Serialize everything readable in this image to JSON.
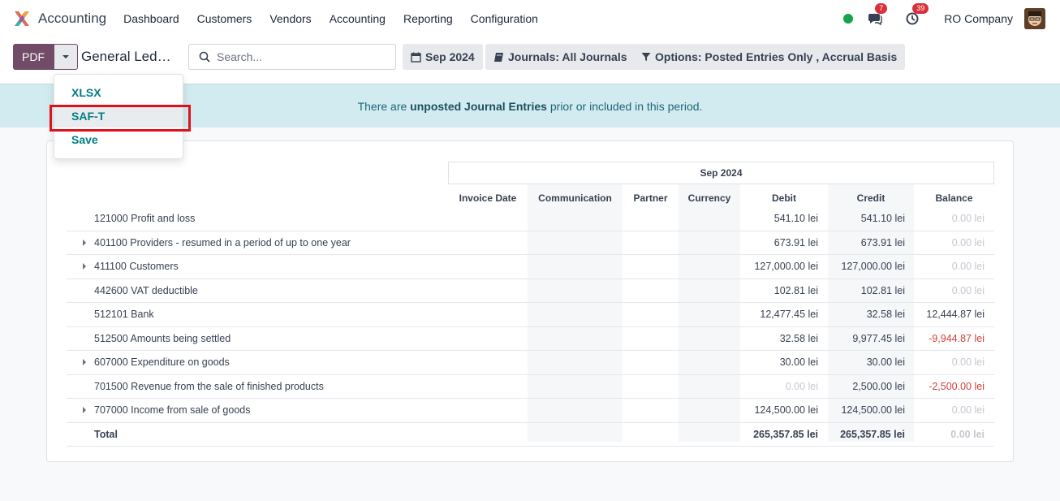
{
  "navbar": {
    "app_name": "Accounting",
    "menu": [
      "Dashboard",
      "Customers",
      "Vendors",
      "Accounting",
      "Reporting",
      "Configuration"
    ],
    "messages_badge": "7",
    "activities_badge": "39",
    "company": "RO Company"
  },
  "control": {
    "pdf_label": "PDF",
    "report_title": "General Led…",
    "search_placeholder": "Search...",
    "date_filter": "Sep 2024",
    "journals_filter": "Journals: All Journals",
    "options_filter": "Options: Posted Entries Only , Accrual Basis"
  },
  "alert": {
    "prefix": "There are ",
    "link": "unposted Journal Entries",
    "suffix": " prior or included in this period."
  },
  "dropdown": {
    "items": [
      "XLSX",
      "SAF-T",
      "Save"
    ]
  },
  "table": {
    "period": "Sep 2024",
    "columns": [
      "Invoice Date",
      "Communication",
      "Partner",
      "Currency",
      "Debit",
      "Credit",
      "Balance"
    ],
    "rows": [
      {
        "name": "121000 Profit and loss",
        "expandable": false,
        "debit": "541.10 lei",
        "credit": "541.10 lei",
        "balance": "0.00 lei"
      },
      {
        "name": "401100 Providers - resumed in a period of up to one year",
        "expandable": true,
        "debit": "673.91 lei",
        "credit": "673.91 lei",
        "balance": "0.00 lei"
      },
      {
        "name": "411100 Customers",
        "expandable": true,
        "debit": "127,000.00 lei",
        "credit": "127,000.00 lei",
        "balance": "0.00 lei"
      },
      {
        "name": "442600 VAT deductible",
        "expandable": false,
        "debit": "102.81 lei",
        "credit": "102.81 lei",
        "balance": "0.00 lei"
      },
      {
        "name": "512101 Bank",
        "expandable": false,
        "debit": "12,477.45 lei",
        "credit": "32.58 lei",
        "balance": "12,444.87 lei"
      },
      {
        "name": "512500 Amounts being settled",
        "expandable": false,
        "debit": "32.58 lei",
        "credit": "9,977.45 lei",
        "balance": "-9,944.87 lei"
      },
      {
        "name": "607000 Expenditure on goods",
        "expandable": true,
        "debit": "30.00 lei",
        "credit": "30.00 lei",
        "balance": "0.00 lei"
      },
      {
        "name": "701500 Revenue from the sale of finished products",
        "expandable": false,
        "debit": "0.00 lei",
        "credit": "2,500.00 lei",
        "balance": "-2,500.00 lei"
      },
      {
        "name": "707000 Income from sale of goods",
        "expandable": true,
        "debit": "124,500.00 lei",
        "credit": "124,500.00 lei",
        "balance": "0.00 lei"
      }
    ],
    "total": {
      "name": "Total",
      "debit": "265,357.85 lei",
      "credit": "265,357.85 lei",
      "balance": "0.00 lei"
    }
  },
  "colors": {
    "brand": "#714b67",
    "link": "#017e84",
    "negative": "#d23f3a",
    "alert_bg": "#d2ebf0",
    "highlight": "#e0101a"
  }
}
